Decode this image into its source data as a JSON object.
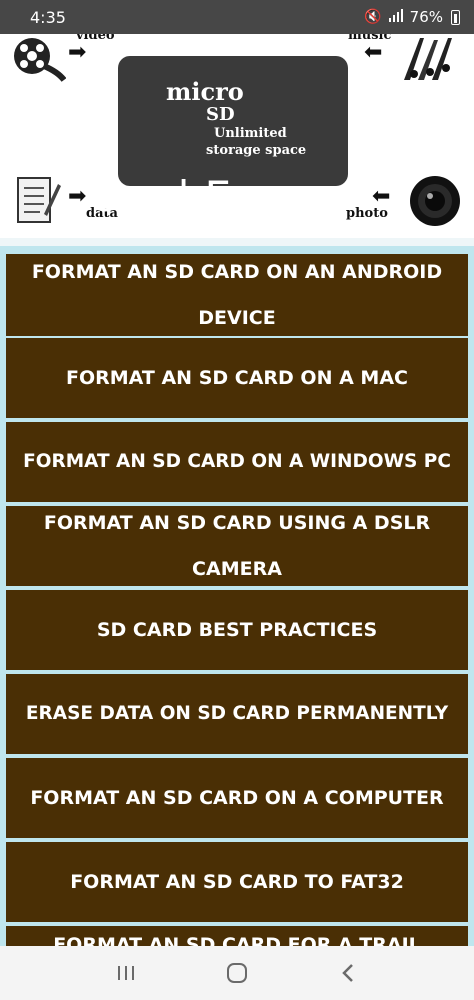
{
  "status": {
    "time": "4:35",
    "battery": "76%"
  },
  "banner": {
    "card_micro": "micro",
    "card_sd": "SD",
    "card_line1": "Unlimited",
    "card_line2": "storage space",
    "label_video": "video",
    "label_music": "music",
    "label_data": "data",
    "label_photo": "photo",
    "overlay_title": "Card Era"
  },
  "menu": {
    "items": [
      {
        "line1": "FORMAT AN SD CARD ON AN ANDROID",
        "line2": "DEVICE"
      },
      {
        "line1": "FORMAT AN SD CARD ON A MAC",
        "line2": ""
      },
      {
        "line1": "FORMAT AN SD CARD ON A WINDOWS PC",
        "line2": ""
      },
      {
        "line1": "FORMAT AN SD CARD USING A DSLR",
        "line2": "CAMERA"
      },
      {
        "line1": "SD CARD BEST PRACTICES",
        "line2": ""
      },
      {
        "line1": "ERASE DATA ON SD CARD PERMANENTLY",
        "line2": ""
      },
      {
        "line1": "FORMAT AN SD CARD ON A COMPUTER",
        "line2": ""
      },
      {
        "line1": "FORMAT AN SD CARD TO FAT32",
        "line2": ""
      },
      {
        "line1": "FORMAT AN SD CARD FOR A TRAIL",
        "line2": ""
      }
    ]
  },
  "colors": {
    "menu_item_bg": "#4a2f05",
    "menu_bg": "#bfe6ee",
    "status_bar": "#474747"
  }
}
